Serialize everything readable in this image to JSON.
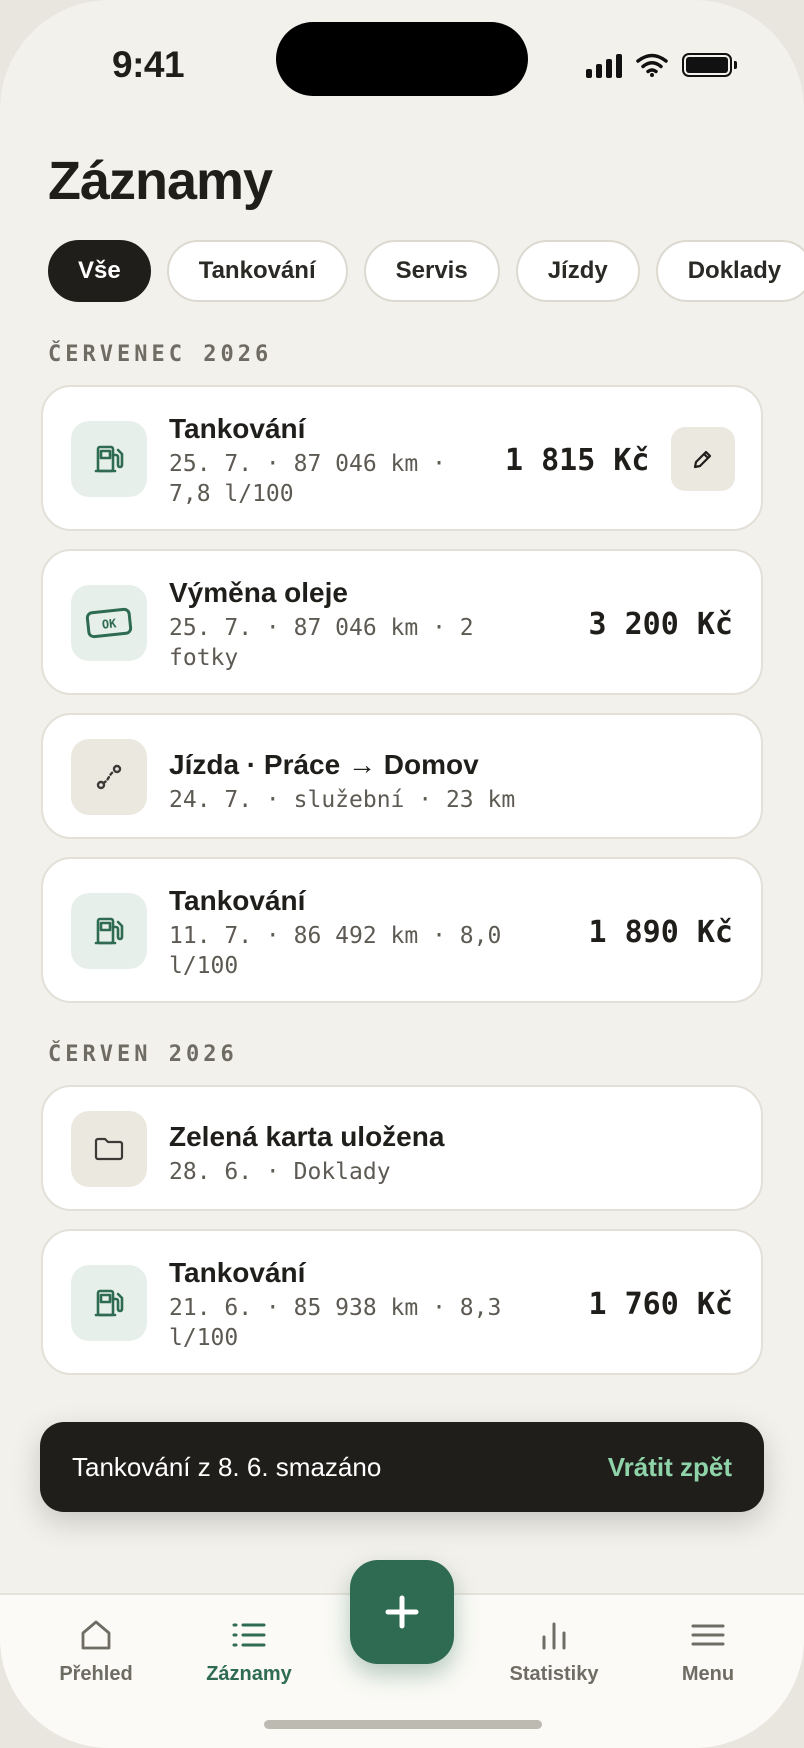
{
  "status": {
    "time": "9:41"
  },
  "page": {
    "title": "Záznamy"
  },
  "filters": [
    "Vše",
    "Tankování",
    "Servis",
    "Jízdy",
    "Doklady"
  ],
  "sections": [
    {
      "label": "ČERVENEC 2026",
      "items": [
        {
          "title": "Tankování",
          "meta_line1": "25. 7. · 87 046 km ·",
          "meta_line2": "7,8 l/100",
          "amount": "1 815 Kč",
          "icon": "fuel-pump-icon"
        },
        {
          "title": "Výměna oleje",
          "meta_line1": "25. 7. · 87 046 km · 2",
          "meta_line2": "fotky",
          "amount": "3 200 Kč",
          "icon": "ok-ticket-icon"
        },
        {
          "title": "Jízda · Práce → Domov",
          "meta_line1": "24. 7. · služební · 23 km",
          "icon": "route-icon"
        },
        {
          "title": "Tankování",
          "meta_line1": "11. 7. · 86 492 km · 8,0",
          "meta_line2": "l/100",
          "amount": "1 890 Kč",
          "icon": "fuel-pump-icon"
        }
      ]
    },
    {
      "label": "ČERVEN 2026",
      "items": [
        {
          "title": "Zelená karta uložena",
          "meta_line1": "28. 6. · Doklady",
          "icon": "folder-icon"
        },
        {
          "title": "Tankování",
          "meta_line1": "21. 6. · 85 938 km · 8,3",
          "meta_line2": "l/100",
          "amount": "1 760 Kč",
          "icon": "fuel-pump-icon"
        }
      ]
    }
  ],
  "toast": {
    "text": "Tankování z 8. 6. smazáno",
    "action": "Vrátit zpět"
  },
  "tabbar": {
    "items": [
      "Přehled",
      "Záznamy",
      "Statistiky",
      "Menu"
    ],
    "active": "Záznamy"
  },
  "colors": {
    "accent": "#2e6b52",
    "dark": "#1f1e1b",
    "background": "#f3f1eb",
    "toast_action": "#8fd3a9"
  }
}
